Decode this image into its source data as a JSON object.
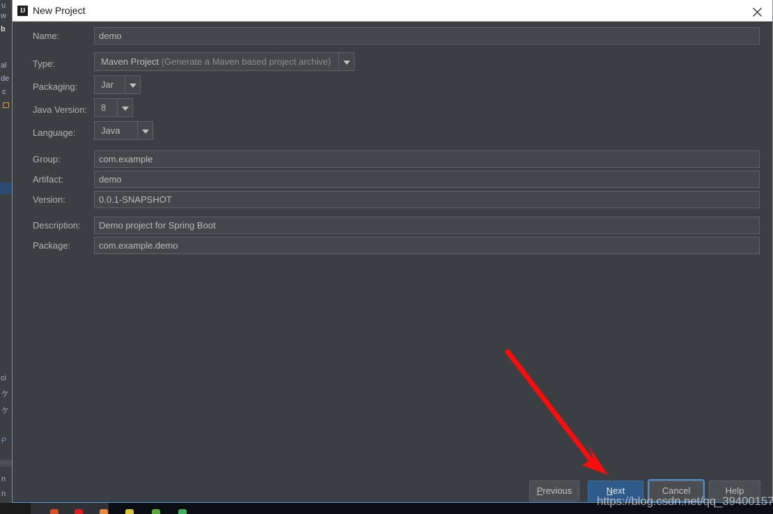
{
  "window": {
    "title": "New Project",
    "logo_text": "IJ",
    "close_icon": "close-icon"
  },
  "form": {
    "fields": [
      {
        "label": "Name:",
        "value": "demo",
        "type": "text"
      },
      {
        "label": "Type:",
        "value": "Maven Project",
        "hint": "(Generate a Maven based project archive)",
        "type": "combo"
      },
      {
        "label": "Packaging:",
        "value": "Jar",
        "type": "combo"
      },
      {
        "label": "Java Version:",
        "value": "8",
        "type": "combo"
      },
      {
        "label": "Language:",
        "value": "Java",
        "type": "combo"
      },
      {
        "label": "Group:",
        "value": "com.example",
        "type": "text"
      },
      {
        "label": "Artifact:",
        "value": "demo",
        "type": "text"
      },
      {
        "label": "Version:",
        "value": "0.0.1-SNAPSHOT",
        "type": "text"
      },
      {
        "label": "Description:",
        "value": "Demo project for Spring Boot",
        "type": "text"
      },
      {
        "label": "Package:",
        "value": "com.example.demo",
        "type": "text"
      }
    ]
  },
  "buttons": {
    "previous": {
      "prefix": "",
      "mnemonic": "P",
      "suffix": "revious"
    },
    "next": {
      "prefix": "",
      "mnemonic": "N",
      "suffix": "ext"
    },
    "cancel": {
      "label": "Cancel"
    },
    "help": {
      "label": "Help"
    }
  },
  "annotation": {
    "arrow_color": "#fb0d0d",
    "watermark": "https://blog.csdn.net/qq_39400157"
  },
  "ide_background": {
    "left_fragments": [
      "w",
      "b",
      "al",
      "de",
      "c",
      "ci",
      "P",
      "n",
      "n"
    ],
    "accent_color": "#2f79c4"
  }
}
